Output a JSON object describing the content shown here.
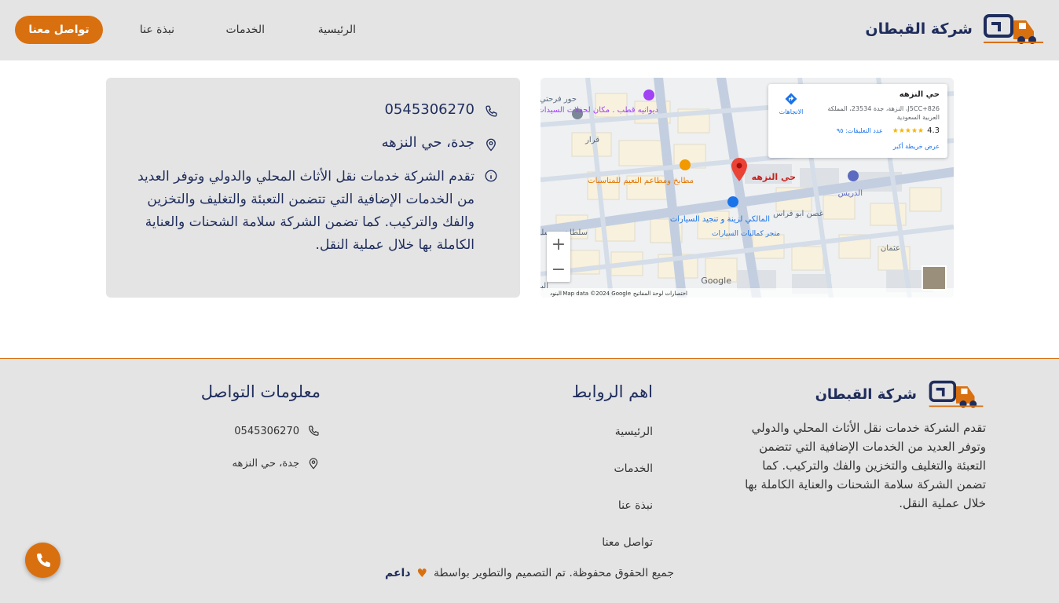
{
  "header": {
    "brand_name": "شركة القبطان",
    "nav": [
      "الرئيسية",
      "الخدمات",
      "نبذة عنا"
    ],
    "cta_label": "تواصل معنا"
  },
  "contact_card": {
    "phone": "0545306270",
    "address": "جدة، حي النزهه",
    "description": "تقدم الشركة خدمات نقل الأثاث المحلي والدولي وتوفر العديد من الخدمات الإضافية التي تتضمن التعبئة والتغليف والتخزين والفك والتركيب. كما تضمن الشركة سلامة الشحنات والعناية الكاملة بها خلال عملية النقل."
  },
  "map": {
    "place_title": "حي النزهه",
    "place_address": "J5CC+826، النزهة، جدة 23534، المملكة العربية السعودية",
    "directions_label": "الاتجاهات",
    "rating": "4.3",
    "reviews": "عدد التعليقات: ٩٥",
    "view_larger": "عرض خريطة أكبر",
    "pin_label": "حي النزهه",
    "labels": {
      "diwaniya": "ديوانيه قطب . مكان لحفلات السيدات",
      "kitchen": "مطابخ ومطاعم النعيم للمناسبات",
      "maliki": "المالكي لزينة و تنجيد السيارات",
      "maliki_sub": "متجر كماليات السيارات",
      "drees": "الدريس",
      "sultan": "سلطان بن سلمان",
      "ghusn": "غصن ابو فراس",
      "khor": "حور فرحتي",
      "qarar": "قرار",
      "uthman": "عثمان",
      "ahli": "البنك الاهلي"
    },
    "zoom_in": "+",
    "zoom_out": "−",
    "google": "Google",
    "attribution": "Map data ©2024 Google",
    "shortcuts": "اختصارات لوحة المفاتيح",
    "terms": "البنود"
  },
  "footer": {
    "brand_name": "شركة القبطان",
    "description": "تقدم الشركة خدمات نقل الأثاث المحلي والدولي وتوفر العديد من الخدمات الإضافية التي تتضمن التعبئة والتغليف والتخزين والفك والتركيب. كما تضمن الشركة سلامة الشحنات والعناية الكاملة بها خلال عملية النقل.",
    "links_heading": "اهم الروابط",
    "links": [
      "الرئيسية",
      "الخدمات",
      "نبذة عنا",
      "تواصل معنا"
    ],
    "contact_heading": "معلومات التواصل",
    "phone": "0545306270",
    "address": "جدة، حي النزهه",
    "copyright": "جميع الحقوق محفوظة. تم التصميم والتطوير بواسطة",
    "developer": "داعم"
  },
  "colors": {
    "accent": "#d9700f",
    "navy": "#1f2d5c",
    "panel": "#e4e4e4"
  }
}
